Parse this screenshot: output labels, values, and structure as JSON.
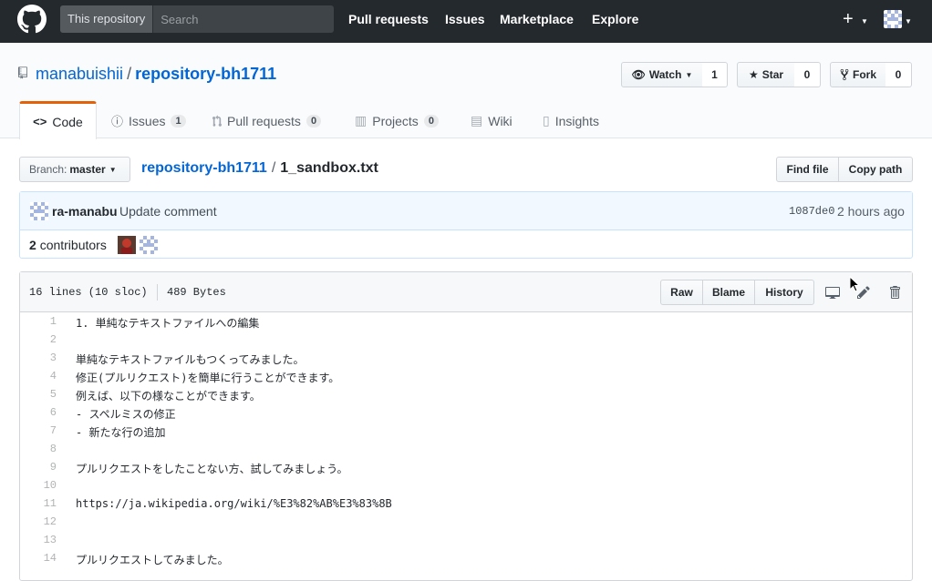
{
  "header": {
    "search_scope": "This repository",
    "search_placeholder": "Search",
    "nav": [
      "Pull requests",
      "Issues",
      "Marketplace",
      "Explore"
    ],
    "plus": "+"
  },
  "repo": {
    "owner": "manabuishii",
    "separator": "/",
    "name": "repository-bh1711",
    "watch_label": "Watch",
    "watch_count": "1",
    "star_label": "Star",
    "star_count": "0",
    "fork_label": "Fork",
    "fork_count": "0"
  },
  "tabs": [
    {
      "label": "Code",
      "icon": "code-icon"
    },
    {
      "label": "Issues",
      "count": "1",
      "icon": "issue-icon"
    },
    {
      "label": "Pull requests",
      "count": "0",
      "icon": "pull-request-icon"
    },
    {
      "label": "Projects",
      "count": "0",
      "icon": "project-icon"
    },
    {
      "label": "Wiki",
      "icon": "book-icon"
    },
    {
      "label": "Insights",
      "icon": "graph-icon"
    }
  ],
  "breadcrumb": {
    "branch_prefix": "Branch:",
    "branch_name": "master",
    "repo": "repository-bh1711",
    "slash": "/",
    "file": "1_sandbox.txt",
    "find_file": "Find file",
    "copy_path": "Copy path"
  },
  "commit": {
    "author": "ra-manabu",
    "message": "Update comment",
    "sha": "1087de0",
    "time": "2 hours ago",
    "contributors_count": "2",
    "contributors_label": "contributors"
  },
  "file": {
    "lines_info": "16 lines (10 sloc)",
    "size": "489 Bytes",
    "raw": "Raw",
    "blame": "Blame",
    "history": "History",
    "lines": [
      {
        "n": "1",
        "text": "1. 単純なテキストファイルへの編集"
      },
      {
        "n": "2",
        "text": ""
      },
      {
        "n": "3",
        "text": "単純なテキストファイルもつくってみました。"
      },
      {
        "n": "4",
        "text": "修正(プルリクエスト)を簡単に行うことができます。"
      },
      {
        "n": "5",
        "text": "例えば、以下の様なことができます。"
      },
      {
        "n": "6",
        "text": "- スペルミスの修正"
      },
      {
        "n": "7",
        "text": "- 新たな行の追加"
      },
      {
        "n": "8",
        "text": ""
      },
      {
        "n": "9",
        "text": "プルリクエストをしたことない方、試してみましょう。"
      },
      {
        "n": "10",
        "text": ""
      },
      {
        "n": "11",
        "text": "https://ja.wikipedia.org/wiki/%E3%82%AB%E3%83%8B"
      },
      {
        "n": "12",
        "text": ""
      },
      {
        "n": "13",
        "text": ""
      },
      {
        "n": "14",
        "text": "プルリクエストしてみました。"
      }
    ]
  }
}
